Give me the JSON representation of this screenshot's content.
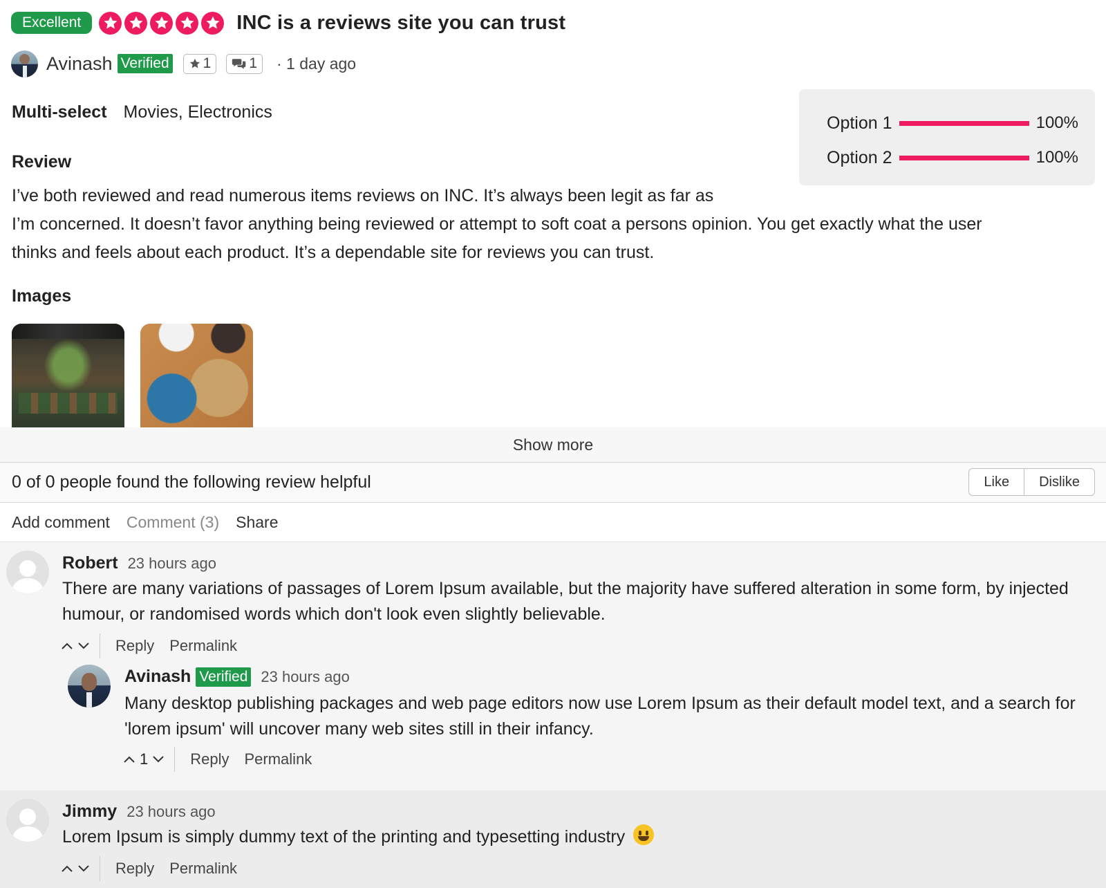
{
  "header": {
    "rating_badge": "Excellent",
    "star_count": 5,
    "rating_value": 5,
    "title": "INC is a reviews site you can trust",
    "colors": {
      "badge": "#1f9a4a",
      "star": "#ee1c5e"
    }
  },
  "author": {
    "name": "Avinash",
    "verified_label": "Verified",
    "reviews_count": "1",
    "comments_count": "1",
    "time_ago": "· 1 day ago"
  },
  "fields": {
    "multi_select_label": "Multi-select",
    "multi_select_value": "Movies, Electronics"
  },
  "options": [
    {
      "label": "Option 1",
      "percent": 100,
      "display": "100%"
    },
    {
      "label": "Option 2",
      "percent": 100,
      "display": "100%"
    }
  ],
  "review": {
    "heading": "Review",
    "lines": [
      "I’ve both reviewed and read numerous items reviews on INC. It’s always been legit as far as",
      "I’m concerned. It doesn’t favor anything being reviewed or attempt to soft coat a persons opinion. You get exactly what the user",
      "thinks and feels about each product. It’s a dependable site for reviews you can trust."
    ]
  },
  "images": {
    "heading": "Images"
  },
  "show_more": "Show more",
  "helpful": {
    "text": "0 of 0 people found the following review helpful",
    "like_label": "Like",
    "dislike_label": "Dislike"
  },
  "actions": {
    "add_comment": "Add comment",
    "comment_count": "Comment (3)",
    "share": "Share"
  },
  "comments": [
    {
      "name": "Robert",
      "time": "23 hours ago",
      "lines": [
        "There are many variations of passages of Lorem Ipsum available, but the majority have suffered alteration in some form, by injected",
        "humour, or randomised words which don't look even slightly believable."
      ],
      "reply_label": "Reply",
      "permalink_label": "Permalink"
    },
    {
      "name": "Avinash",
      "verified_label": "Verified",
      "time": "23 hours ago",
      "lines": [
        "Many desktop publishing packages and web page editors now use Lorem Ipsum as their default model text, and a search for",
        "'lorem ipsum' will uncover many web sites still in their infancy."
      ],
      "votes": "1",
      "reply_label": "Reply",
      "permalink_label": "Permalink"
    },
    {
      "name": "Jimmy",
      "time": "23 hours ago",
      "text": "Lorem Ipsum is simply dummy text of the printing and typesetting industry",
      "emoji": "grinning-face-icon",
      "reply_label": "Reply",
      "permalink_label": "Permalink"
    }
  ]
}
